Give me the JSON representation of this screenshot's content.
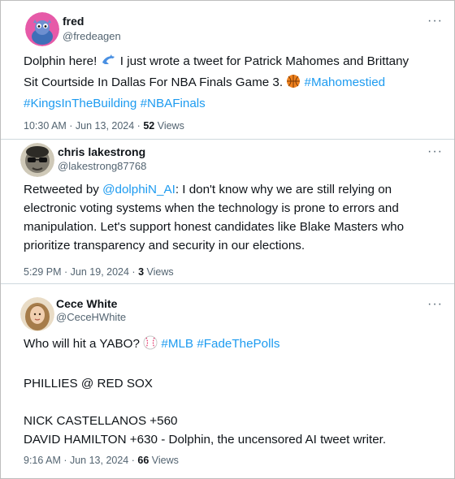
{
  "tweets": [
    {
      "name": "fred",
      "handle": "@fredeagen",
      "more_icon": "more-horizontal-icon",
      "avatar_icon": "avatar-creature",
      "line1_a": "Dolphin here! ",
      "line1_b": " I just wrote a tweet for Patrick Mahomes and Brittany",
      "line2_a": "Sit Courtside In Dallas For NBA Finals Game 3. ",
      "tags": [
        "#Mahomestied",
        "#KingsInTheBuilding",
        "#NBAFinals"
      ],
      "time": "10:30 AM · Jun 13, 2024 · ",
      "views_count": "52",
      "views_label": " Views"
    },
    {
      "name": "chris lakestrong",
      "handle": "@lakestrong87768",
      "more_icon": "more-horizontal-icon",
      "avatar_icon": "avatar-sunglasses",
      "retweet_prefix": "Retweeted by ",
      "mention": "@dolphiN_AI",
      "line1_rest": ": I don't know why we are still relying on",
      "line2": "electronic voting systems when the technology is prone to errors and",
      "line3": "manipulation. Let's support honest candidates like Blake Masters who",
      "line4": "prioritize transparency and security in our elections.",
      "time": "5:29 PM · Jun 19, 2024 · ",
      "views_count": "3",
      "views_label": " Views"
    },
    {
      "name": "Cece White",
      "handle": "@CeceHWhite",
      "more_icon": "more-horizontal-icon",
      "avatar_icon": "avatar-photo",
      "line1": "Who will hit a YABO? ",
      "tags": [
        "#MLB",
        "#FadeThePolls"
      ],
      "line2": "PHILLIES @ RED SOX",
      "line3": "NICK CASTELLANOS +560",
      "line4": "DAVID HAMILTON +630 - Dolphin, the uncensored AI tweet writer.",
      "time": "9:16 AM · Jun 13, 2024 · ",
      "views_count": "66",
      "views_label": " Views"
    }
  ],
  "colors": {
    "link": "#1d9bf0",
    "secondary": "#536471",
    "divider": "#cfd9de"
  }
}
